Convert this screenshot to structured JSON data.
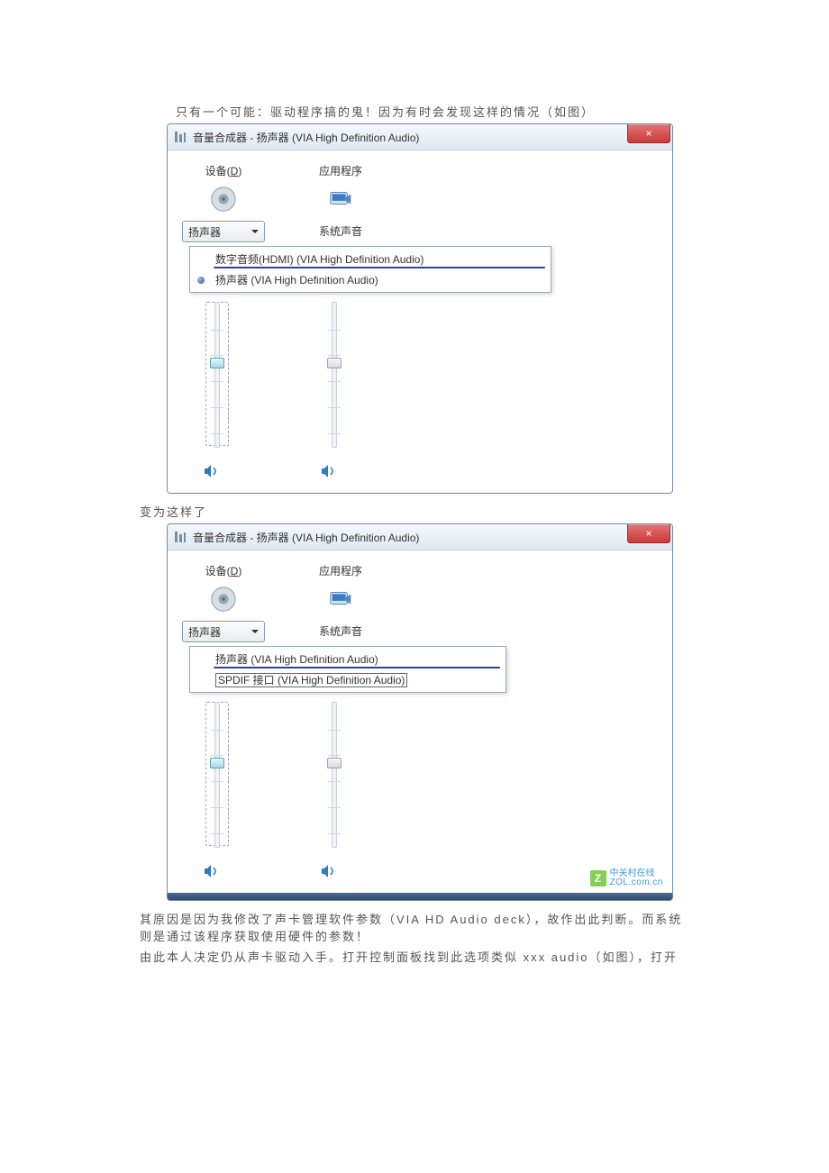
{
  "doc": {
    "line1": "只有一个可能：驱动程序搞的鬼！因为有时会发现这样的情况（如图）",
    "line2": "变为这样了",
    "line3": "其原因是因为我修改了声卡管理软件参数（VIA HD Audio deck），故作出此判断。而系统则是通过该程序获取使用硬件的参数！",
    "line4": "由此本人决定仍从声卡驱动入手。打开控制面板找到此选项类似 xxx audio（如图），打开"
  },
  "window1": {
    "title": "音量合成器 - 扬声器 (VIA High Definition Audio)",
    "close": "×",
    "deviceHeader": "设备(",
    "deviceHeaderU": "D",
    "deviceHeaderEnd": ")",
    "appHeader": "应用程序",
    "dropdownLabel": "扬声器",
    "systemSounds": "系统声音",
    "menu": {
      "item1": "数字音频(HDMI) (VIA High Definition Audio)",
      "item2": "扬声器 (VIA High Definition Audio)"
    }
  },
  "window2": {
    "title": "音量合成器 - 扬声器 (VIA High Definition Audio)",
    "close": "×",
    "deviceHeader": "设备(",
    "deviceHeaderU": "D",
    "deviceHeaderEnd": ")",
    "appHeader": "应用程序",
    "dropdownLabel": "扬声器",
    "systemSounds": "系统声音",
    "menu": {
      "item1": "扬声器 (VIA High Definition Audio)",
      "item2": "SPDIF 接口 (VIA High Definition Audio)"
    },
    "watermark": {
      "top": "中关村在线",
      "bot": "ZOL.com.cn"
    }
  }
}
